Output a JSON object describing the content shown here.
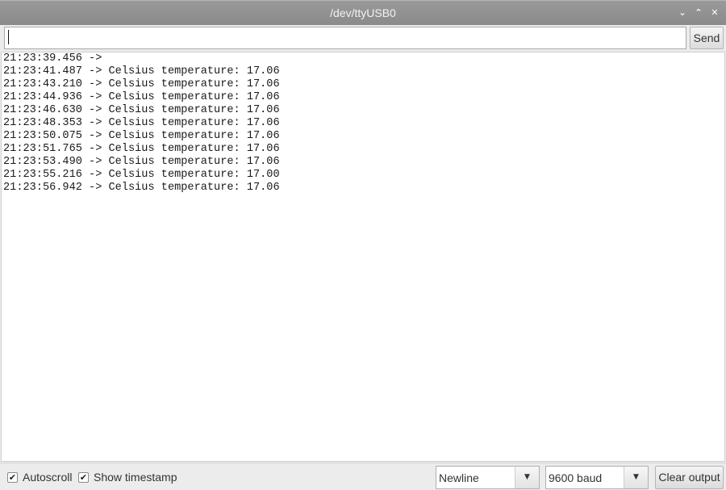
{
  "window": {
    "title": "/dev/ttyUSB0",
    "controls": {
      "minimize": "⌄",
      "maximize": "⌃",
      "close": "✕"
    }
  },
  "send_bar": {
    "input_value": "",
    "send_label": "Send"
  },
  "output": {
    "lines": [
      "21:23:39.456 -> ",
      "21:23:41.487 -> Celsius temperature: 17.06",
      "21:23:43.210 -> Celsius temperature: 17.06",
      "21:23:44.936 -> Celsius temperature: 17.06",
      "21:23:46.630 -> Celsius temperature: 17.06",
      "21:23:48.353 -> Celsius temperature: 17.06",
      "21:23:50.075 -> Celsius temperature: 17.06",
      "21:23:51.765 -> Celsius temperature: 17.06",
      "21:23:53.490 -> Celsius temperature: 17.06",
      "21:23:55.216 -> Celsius temperature: 17.00",
      "21:23:56.942 -> Celsius temperature: 17.06"
    ]
  },
  "bottom_bar": {
    "autoscroll": {
      "label": "Autoscroll",
      "checked": true
    },
    "show_timestamp": {
      "label": "Show timestamp",
      "checked": true
    },
    "line_ending": {
      "selected": "Newline"
    },
    "baud_rate": {
      "selected": "9600 baud"
    },
    "clear_label": "Clear output"
  },
  "icons": {
    "check": "✔",
    "dropdown": "▼"
  }
}
